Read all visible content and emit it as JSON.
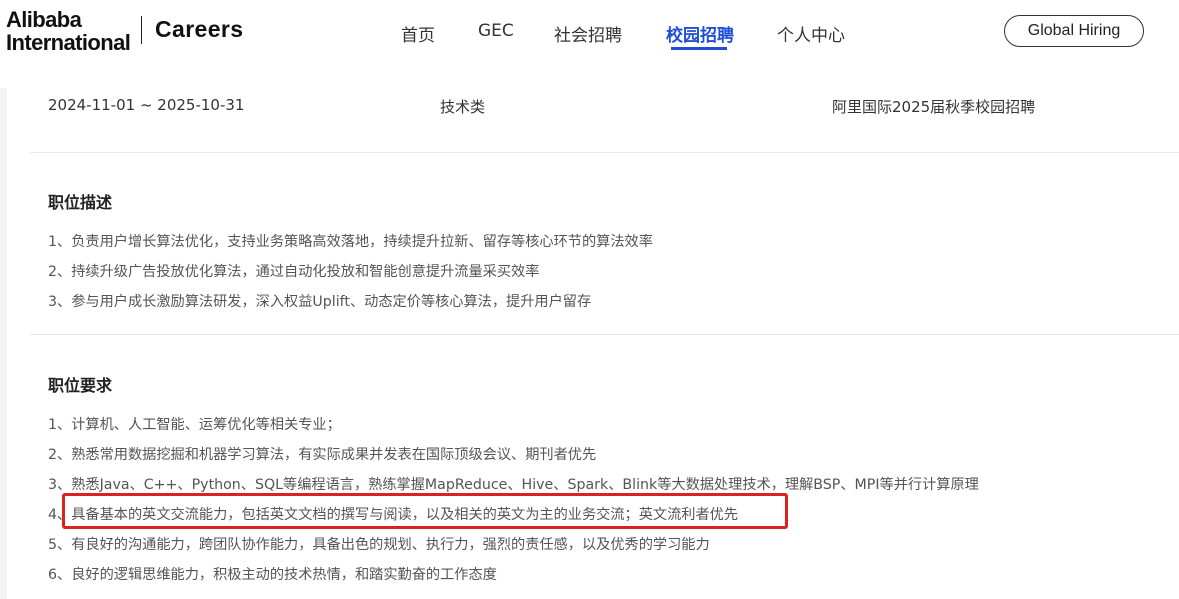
{
  "header": {
    "logo_line1": "Alibaba",
    "logo_line2": "International",
    "brand": "Careers",
    "nav": [
      {
        "label": "首页"
      },
      {
        "label": "GEC"
      },
      {
        "label": "社会招聘"
      },
      {
        "label": "校园招聘",
        "active": true
      },
      {
        "label": "个人中心"
      }
    ],
    "global_button": "Global Hiring",
    "accent_color": "#1f4fd6"
  },
  "job_meta": {
    "date_range": "2024-11-01 ~ 2025-10-31",
    "category": "技术类",
    "program": "阿里国际2025届秋季校园招聘"
  },
  "description": {
    "title": "职位描述",
    "items": [
      "1、负责用户增长算法优化，支持业务策略高效落地，持续提升拉新、留存等核心环节的算法效率",
      "2、持续升级广告投放优化算法，通过自动化投放和智能创意提升流量采买效率",
      "3、参与用户成长激励算法研发，深入权益Uplift、动态定价等核心算法，提升用户留存"
    ]
  },
  "requirements": {
    "title": "职位要求",
    "items": [
      "1、计算机、人工智能、运筹优化等相关专业；",
      "2、熟悉常用数据挖掘和机器学习算法，有实际成果并发表在国际顶级会议、期刊者优先",
      "3、熟悉Java、C++、Python、SQL等编程语言，熟练掌握MapReduce、Hive、Spark、Blink等大数据处理技术，理解BSP、MPI等并行计算原理",
      "4、具备基本的英文交流能力，包括英文文档的撰写与阅读，以及相关的英文为主的业务交流；英文流利者优先",
      "5、有良好的沟通能力，跨团队协作能力，具备出色的规划、执行力，强烈的责任感，以及优秀的学习能力",
      "6、良好的逻辑思维能力，积极主动的技术热情，和踏实勤奋的工作态度"
    ],
    "highlight_color": "#d9231e"
  }
}
